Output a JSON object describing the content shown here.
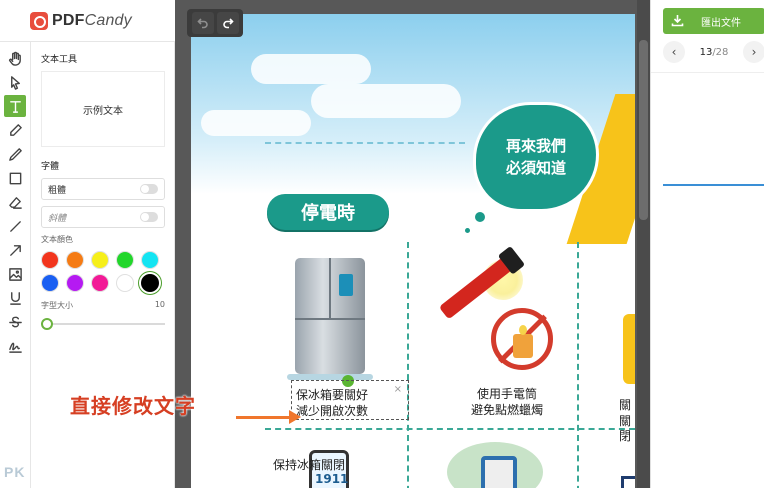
{
  "app": {
    "logo_main": "PDF",
    "logo_italic": "Candy"
  },
  "toolbar": {
    "tools": [
      "hand-icon",
      "pointer-icon",
      "text-icon",
      "pen-icon",
      "pencil-icon",
      "rectangle-icon",
      "eraser-icon",
      "line-icon",
      "arrow-icon",
      "image-icon",
      "underline-icon",
      "strikethrough-icon",
      "signature-icon"
    ],
    "active_tool": "text-icon"
  },
  "props": {
    "section_title": "文本工具",
    "sample_text": "示例文本",
    "font_label": "字體",
    "bold_label": "粗體",
    "italic_label": "斜體",
    "color_label": "文本顏色",
    "colors": [
      "#f2351d",
      "#f57b14",
      "#f6ef1a",
      "#22d62b",
      "#14e4f2",
      "#1a5ff2",
      "#b51af2",
      "#f21a96",
      "#ffffff",
      "#000000"
    ],
    "selected_color": "#000000",
    "size_label": "字型大小",
    "size_value": "10"
  },
  "document": {
    "bubble_line1": "再來我們",
    "bubble_line2": "必須知道",
    "heading": "停電時",
    "edit_line1": "保冰箱要關好",
    "edit_line2": "減少開啟次數",
    "close_mark": "×",
    "flashlight_line1": "使用手電筒",
    "flashlight_line2": "避免點燃蠟燭",
    "right_line1": "關",
    "right_line2": "關閉",
    "fridge_closed_text": "保持冰箱關閉",
    "phone_number": "1911",
    "annotation": "直接修改文字"
  },
  "right_panel": {
    "export_label": "匯出文件",
    "page_current": "13",
    "page_total": "/28",
    "prev": "‹",
    "next": "›"
  },
  "watermark": "PK"
}
